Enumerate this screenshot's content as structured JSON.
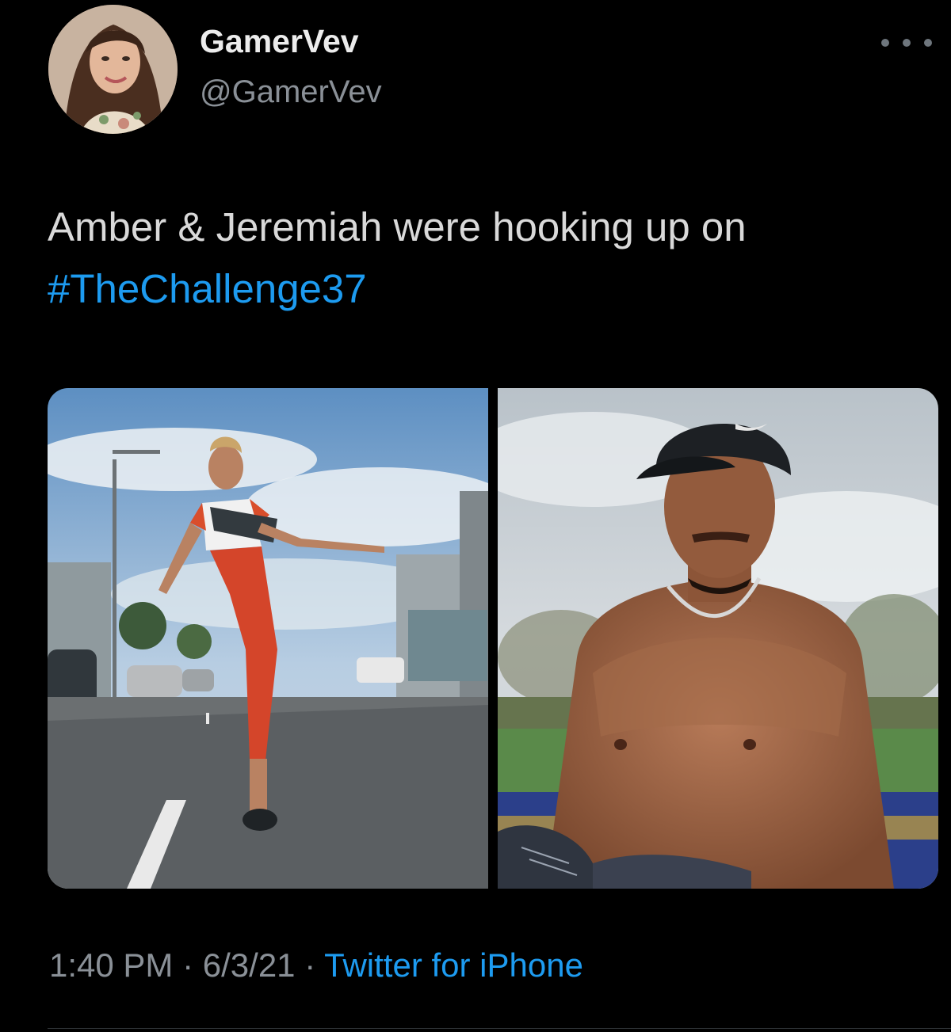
{
  "author": {
    "display_name": "GamerVev",
    "handle": "@GamerVev",
    "avatar_icon": "profile-photo"
  },
  "tweet": {
    "text_prefix": "Amber & Jeremiah were hooking up on ",
    "hashtag": "#TheChallenge37"
  },
  "media": {
    "photos": [
      {
        "name": "woman-jumping-street-photo"
      },
      {
        "name": "shirtless-man-cap-photo",
        "cap_logo": "nike-swoosh-icon"
      }
    ]
  },
  "meta": {
    "time": "1:40 PM",
    "date": "6/3/21",
    "separator": "·",
    "source": "Twitter for iPhone"
  },
  "colors": {
    "background": "#000000",
    "text": "#d9d9d9",
    "secondary": "#8a9097",
    "accent": "#1d9bf0"
  },
  "actions": {
    "more_icon": "more-horizontal-icon"
  }
}
